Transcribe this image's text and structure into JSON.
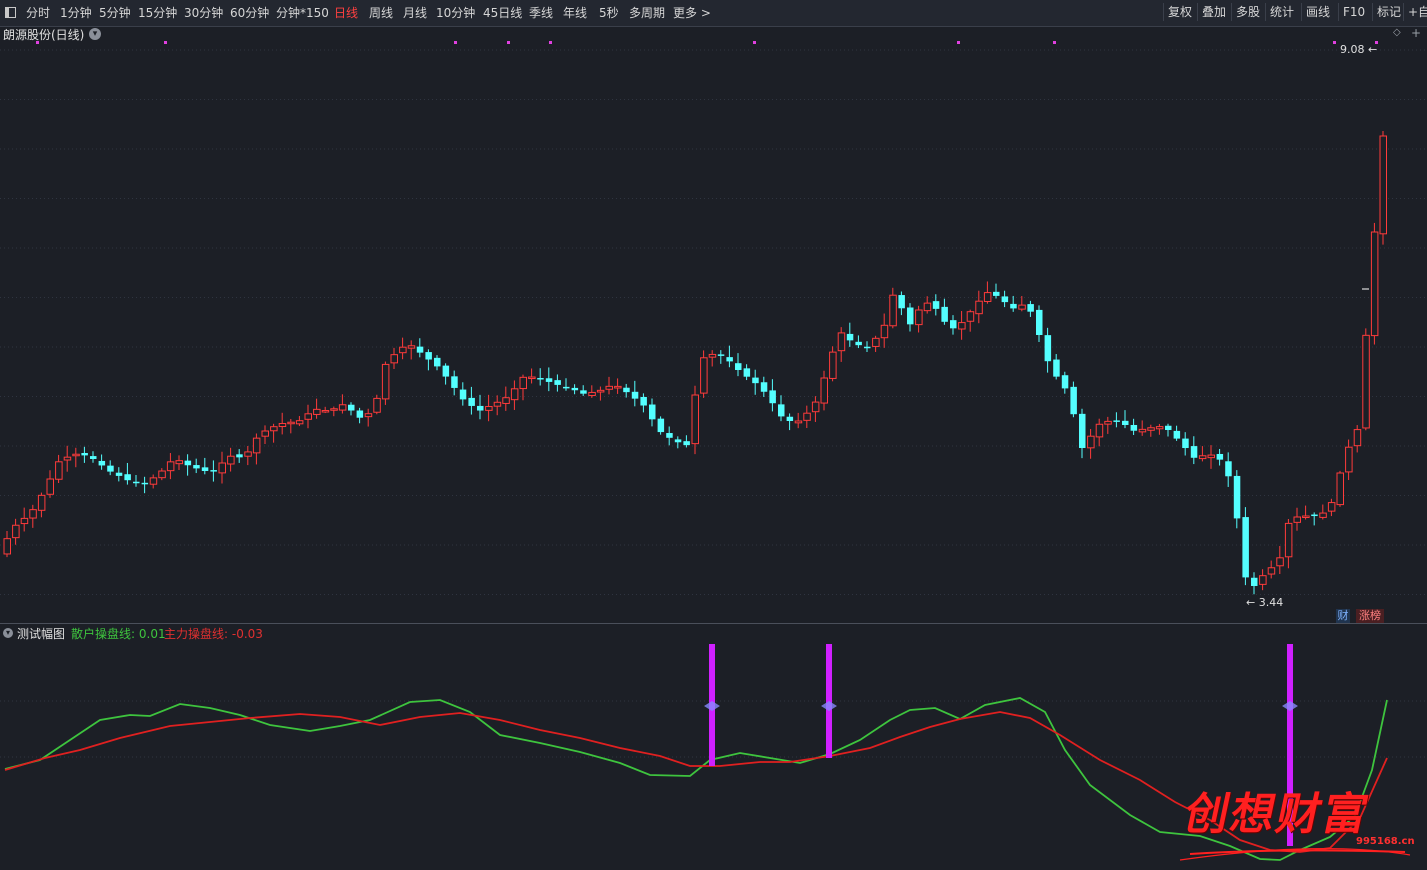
{
  "toolbar": {
    "periods": [
      "分时",
      "1分钟",
      "5分钟",
      "15分钟",
      "30分钟",
      "60分钟",
      "分钟*150",
      "日线",
      "周线",
      "月线",
      "10分钟",
      "45日线",
      "季线",
      "年线",
      "5秒",
      "多周期",
      "更多 >"
    ],
    "active_period": "日线",
    "tools": [
      "复权",
      "叠加",
      "多股",
      "统计",
      "画线",
      "F10",
      "标记",
      "+自"
    ]
  },
  "main_chart": {
    "title": "朗源股份(日线)",
    "high_label": "9.08",
    "low_label": "3.44",
    "up_color": "#ff3b3b",
    "down_color": "#54ffff"
  },
  "indicator": {
    "title": "测试幅图",
    "retail_label": "散户操盘线:",
    "retail_value": "0.01",
    "main_label": "主力操盘线:",
    "main_value": "-0.03",
    "retail_color": "#3ec43e",
    "main_color": "#e02020",
    "signal_color": "#d020ff"
  },
  "badges": {
    "cai": "财",
    "zhangbang": "涨榜"
  },
  "watermark": {
    "text": "创想财富",
    "url": "995168.cn"
  }
}
